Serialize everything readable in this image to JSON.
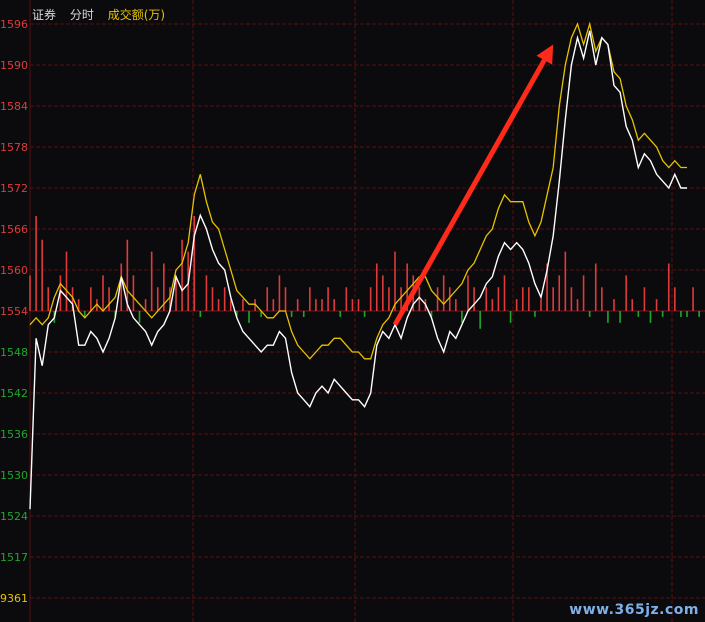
{
  "header": {
    "tab_stock": "证券",
    "tab_intraday": "分时",
    "volume_label": "成交额(万)"
  },
  "watermark": "www.365jz.com",
  "colors": {
    "background": "#0b0b0e",
    "grid": "#5a0f12",
    "price_line": "#ffffff",
    "avg_line": "#e6c200",
    "up_bar": "#e03a3a",
    "down_bar": "#1fa62c",
    "arrow": "#ff2a1a",
    "label_up": "#e03a3a",
    "label_down": "#1fa62c"
  },
  "chart_data": {
    "type": "line",
    "title": "",
    "baseline": 1554,
    "ylim": [
      1524,
      1596
    ],
    "y_ticks": [
      {
        "label": "1596",
        "value": 1596,
        "side": "up"
      },
      {
        "label": "1590",
        "value": 1590,
        "side": "up"
      },
      {
        "label": "1584",
        "value": 1584,
        "side": "up"
      },
      {
        "label": "1578",
        "value": 1578,
        "side": "up"
      },
      {
        "label": "1572",
        "value": 1572,
        "side": "up"
      },
      {
        "label": "1566",
        "value": 1566,
        "side": "up"
      },
      {
        "label": "1560",
        "value": 1560,
        "side": "up"
      },
      {
        "label": "1554",
        "value": 1554,
        "side": "flat"
      },
      {
        "label": "1548",
        "value": 1548,
        "side": "down"
      },
      {
        "label": "1542",
        "value": 1542,
        "side": "down"
      },
      {
        "label": "1536",
        "value": 1536,
        "side": "down"
      },
      {
        "label": "1530",
        "value": 1530,
        "side": "down"
      },
      {
        "label": "1524",
        "value": 1524,
        "side": "down"
      }
    ],
    "lower_ticks": [
      {
        "label": "1517",
        "level": 0.5
      },
      {
        "label": "9361",
        "level": 1.0
      }
    ],
    "series": [
      {
        "role": "price",
        "values": [
          1525,
          1550,
          1546,
          1552,
          1553,
          1557,
          1556,
          1555,
          1549,
          1549,
          1551,
          1550,
          1548,
          1550,
          1553,
          1559,
          1555,
          1553,
          1552,
          1551,
          1549,
          1551,
          1552,
          1554,
          1559,
          1557,
          1558,
          1565,
          1568,
          1566,
          1563,
          1561,
          1560,
          1556,
          1553,
          1551,
          1550,
          1549,
          1548,
          1549,
          1549,
          1551,
          1550,
          1545,
          1542,
          1541,
          1540,
          1542,
          1543,
          1542,
          1544,
          1543,
          1542,
          1541,
          1541,
          1540,
          1542,
          1549,
          1551,
          1550,
          1552,
          1550,
          1553,
          1555,
          1556,
          1555,
          1553,
          1550,
          1548,
          1551,
          1550,
          1552,
          1554,
          1555,
          1556,
          1558,
          1559,
          1562,
          1564,
          1563,
          1564,
          1563,
          1561,
          1558,
          1556,
          1560,
          1565,
          1573,
          1582,
          1590,
          1594,
          1591,
          1595,
          1590,
          1594,
          1593,
          1587,
          1586,
          1581,
          1579,
          1575,
          1577,
          1576,
          1574,
          1573,
          1572,
          1574,
          1572,
          1572
        ]
      },
      {
        "role": "average",
        "values": [
          1552,
          1553,
          1552,
          1553,
          1556,
          1558,
          1557,
          1556,
          1554,
          1553,
          1554,
          1555,
          1554,
          1555,
          1556,
          1559,
          1557,
          1556,
          1555,
          1554,
          1553,
          1554,
          1555,
          1556,
          1560,
          1561,
          1564,
          1571,
          1574,
          1570,
          1567,
          1566,
          1563,
          1560,
          1557,
          1556,
          1555,
          1555,
          1554,
          1553,
          1553,
          1554,
          1554,
          1551,
          1549,
          1548,
          1547,
          1548,
          1549,
          1549,
          1550,
          1550,
          1549,
          1548,
          1548,
          1547,
          1547,
          1550,
          1552,
          1553,
          1555,
          1556,
          1557,
          1558,
          1559,
          1559,
          1557,
          1556,
          1555,
          1556,
          1557,
          1558,
          1560,
          1561,
          1563,
          1565,
          1566,
          1569,
          1571,
          1570,
          1570,
          1570,
          1567,
          1565,
          1567,
          1571,
          1575,
          1584,
          1590,
          1594,
          1596,
          1593,
          1596,
          1592,
          1594,
          1593,
          1589,
          1588,
          1584,
          1582,
          1579,
          1580,
          1579,
          1578,
          1576,
          1575,
          1576,
          1575,
          1575
        ]
      }
    ],
    "volume": {
      "max": 9361,
      "values": [
        3,
        8,
        6,
        2,
        -2,
        3,
        5,
        2,
        1,
        -1,
        2,
        1,
        3,
        2,
        -1,
        4,
        6,
        3,
        -2,
        1,
        5,
        2,
        4,
        2,
        3,
        6,
        5,
        8,
        -1,
        3,
        2,
        1,
        2,
        1,
        -1,
        1,
        -2,
        1,
        -1,
        2,
        1,
        3,
        2,
        -1,
        1,
        -1,
        2,
        1,
        1,
        2,
        1,
        -1,
        2,
        1,
        1,
        -1,
        2,
        4,
        3,
        2,
        5,
        2,
        4,
        3,
        2,
        1,
        -1,
        2,
        3,
        2,
        1,
        -2,
        3,
        2,
        -3,
        2,
        1,
        2,
        3,
        -2,
        1,
        2,
        2,
        -1,
        1,
        4,
        2,
        3,
        5,
        2,
        1,
        3,
        -1,
        4,
        2,
        -2,
        1,
        -2,
        3,
        1,
        -1,
        2,
        -2,
        1,
        -1,
        4,
        2,
        -1,
        -1,
        2,
        -1
      ]
    },
    "annotations": [
      {
        "type": "arrow",
        "from": {
          "index": 60,
          "value": 1552
        },
        "to": {
          "index": 86,
          "value": 1593
        }
      }
    ]
  }
}
